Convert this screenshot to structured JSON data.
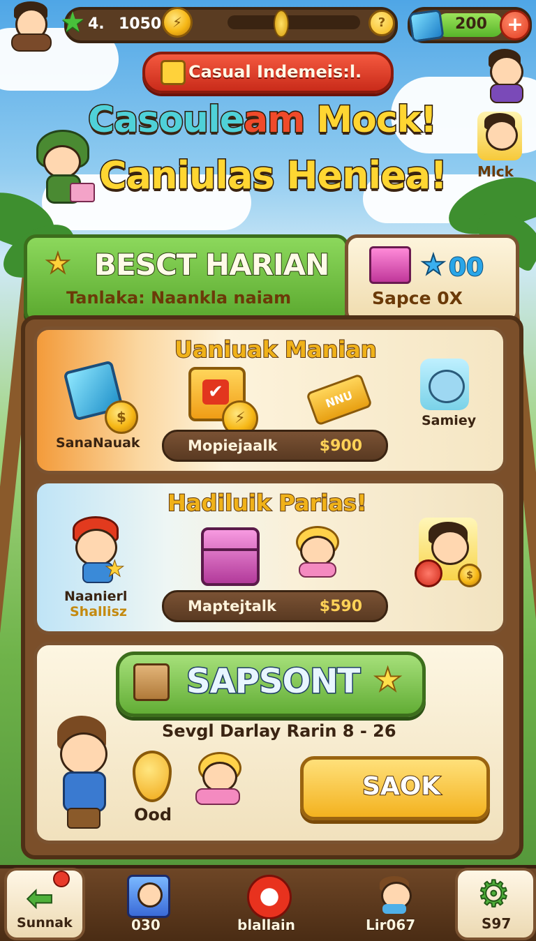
{
  "hud": {
    "level_text": "4.",
    "score": "1050",
    "gems": "200",
    "help_glyph": "?",
    "plus_glyph": "+",
    "coin_glyph": "⚡"
  },
  "banner": {
    "label": "Casual Indemeis:l."
  },
  "title": {
    "line1_a": "Casoule",
    "line1_b": "am",
    "line1_c": " Mock!",
    "line2": "Caniulas Heniea!"
  },
  "side_avatar": {
    "label": "Mlck"
  },
  "daily": {
    "title": "BESCT HARIAN",
    "subtitle": "Tanlaka: Naankla naiam",
    "side_value": "00",
    "side_label": "Sapce 0X"
  },
  "card1": {
    "title": "Uaniuak Manian",
    "item_left": "SanaNauak",
    "item_right": "Samiey",
    "ticket_text": "NNU",
    "pill_label": "Mopiejaalk",
    "pill_value": "$900"
  },
  "card2": {
    "title": "Hadiluik Parias!",
    "item_left_1": "Naanierl",
    "item_left_2": "Shallisz",
    "pill_label": "Maptejtalk",
    "pill_value": "$590"
  },
  "card3": {
    "button_label": "SAPSONT",
    "date_text": "Sevgl Darlay Rarin 8 - 26",
    "reward_label": "Ood",
    "action_label": "SAOK"
  },
  "nav": [
    {
      "label": "Sunnak"
    },
    {
      "label": "030"
    },
    {
      "label": "blallain"
    },
    {
      "label": "Lir067"
    },
    {
      "label": "S97"
    }
  ]
}
